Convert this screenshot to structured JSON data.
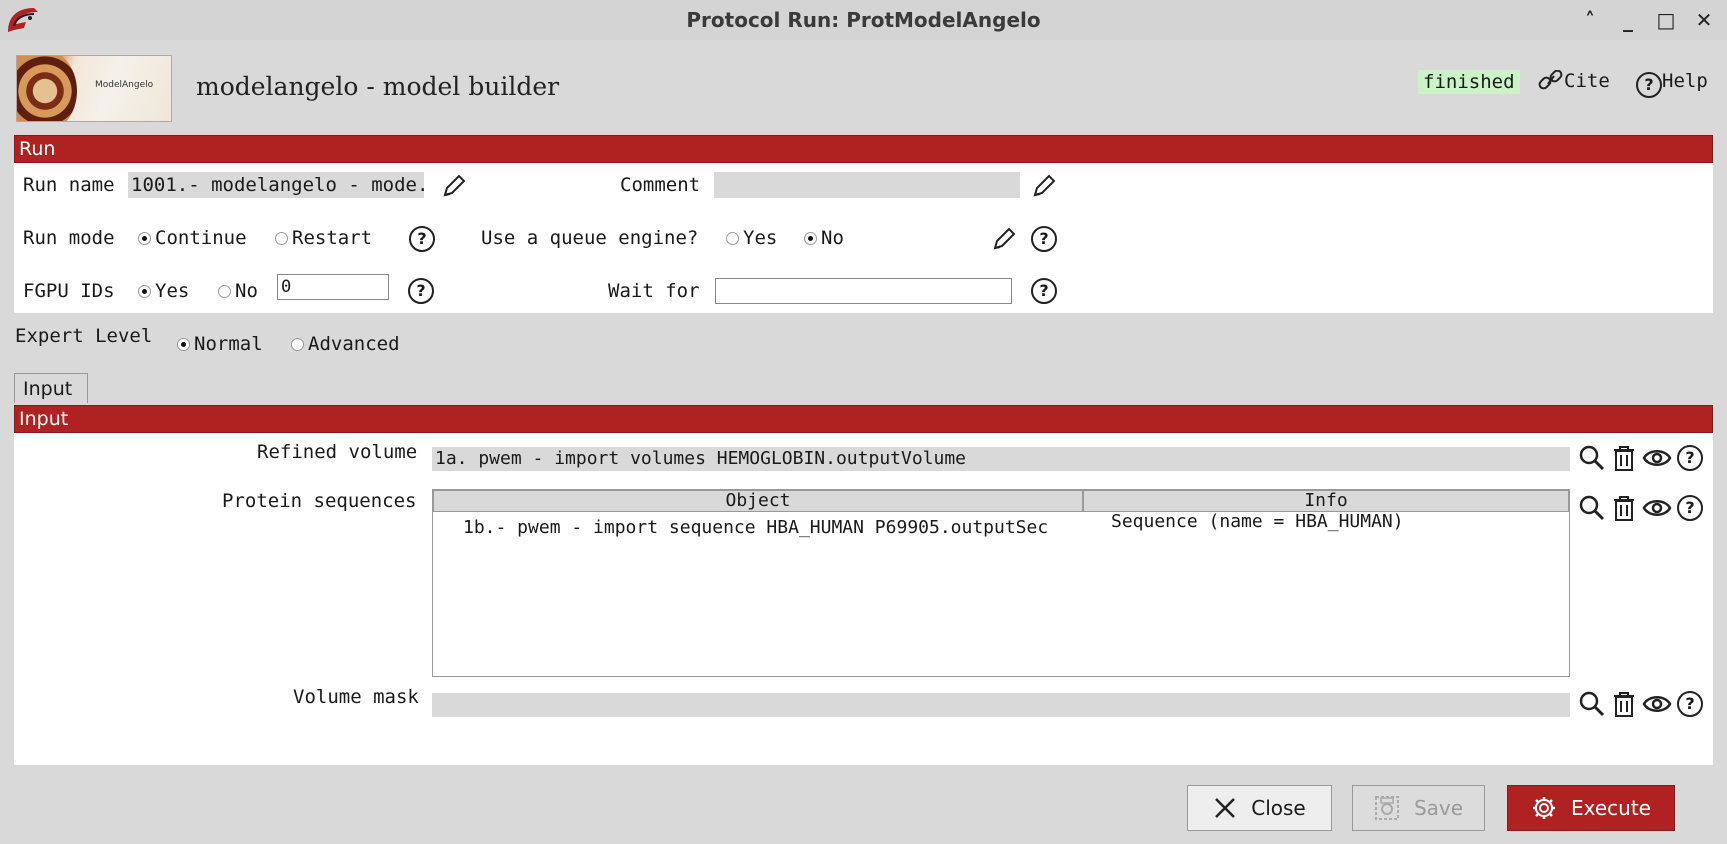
{
  "window": {
    "title": "Protocol Run: ProtModelAngelo"
  },
  "header": {
    "image_label": "ModelAngelo",
    "title": "modelangelo - model builder",
    "status": "finished",
    "cite_label": "Cite",
    "help_label": "Help",
    "status_color": "#ccf2c8"
  },
  "run": {
    "section_title": "Run",
    "run_name_label": "Run name",
    "run_name_value": "1001.- modelangelo - mode.",
    "comment_label": "Comment",
    "comment_value": "",
    "run_mode_label": "Run mode",
    "run_mode_options": [
      "Continue",
      "Restart"
    ],
    "run_mode_selected": "Continue",
    "queue_label": "Use a queue engine?",
    "queue_options": [
      "Yes",
      "No"
    ],
    "queue_selected": "No",
    "gpu_label": "FGPU IDs",
    "gpu_options": [
      "Yes",
      "No"
    ],
    "gpu_selected": "Yes",
    "gpu_value": "0",
    "wait_for_label": "Wait for",
    "wait_for_value": ""
  },
  "expert": {
    "label": "Expert Level",
    "options": [
      "Normal",
      "Advanced"
    ],
    "selected": "Normal"
  },
  "tabs": [
    {
      "label": "Input"
    }
  ],
  "input": {
    "section_title": "Input",
    "refined_volume_label": "Refined volume",
    "refined_volume_value": "1a. pwem - import volumes HEMOGLOBIN.outputVolume",
    "protein_sequences_label": "Protein sequences",
    "table": {
      "columns": [
        "Object",
        "Info"
      ],
      "rows": [
        {
          "object": "1b.- pwem - import sequence HBA_HUMAN P69905.outputSec",
          "info": "Sequence (name = HBA_HUMAN)"
        }
      ]
    },
    "volume_mask_label": "Volume mask",
    "volume_mask_value": ""
  },
  "footer": {
    "close_label": "Close",
    "save_label": "Save",
    "execute_label": "Execute",
    "accent_color": "#b02222"
  }
}
